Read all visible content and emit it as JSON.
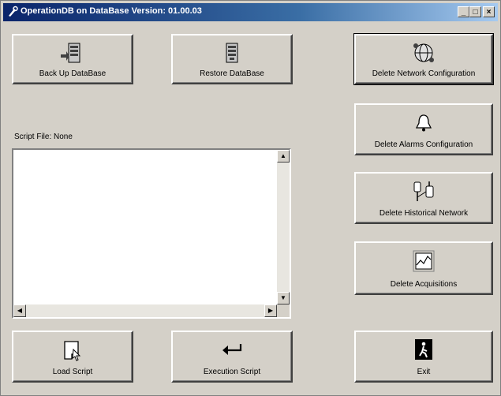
{
  "window": {
    "title": "OperationDB on DataBase Version: 01.00.03",
    "minimize": "_",
    "maximize": "□",
    "close": "×"
  },
  "buttons": {
    "backup": "Back Up DataBase",
    "restore": "Restore DataBase",
    "delete_network": "Delete Network Configuration",
    "delete_alarms": "Delete Alarms Configuration",
    "delete_historical": "Delete Historical Network",
    "delete_acquisitions": "Delete Acquisitions",
    "load_script": "Load Script",
    "execute_script": "Execution Script",
    "exit": "Exit"
  },
  "script_file_label": "Script File: None",
  "scroll": {
    "up": "▲",
    "down": "▼",
    "left": "◀",
    "right": "▶"
  }
}
